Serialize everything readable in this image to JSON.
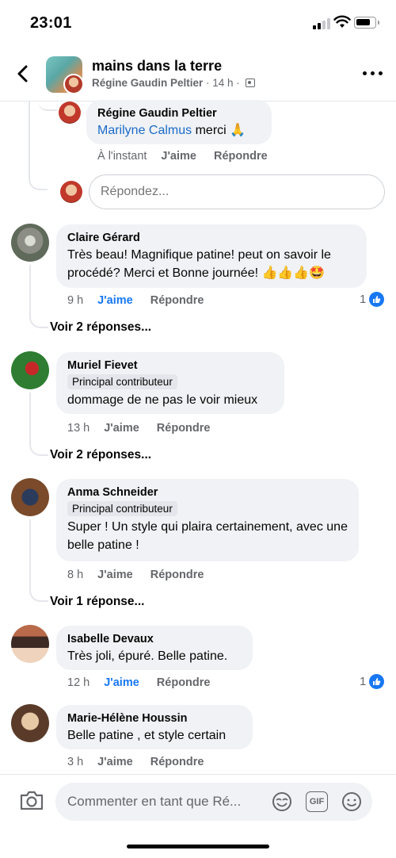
{
  "status_bar": {
    "time": "23:01"
  },
  "header": {
    "title": "mains dans la terre",
    "author": "Régine Gaudin Peltier",
    "time": " · 14 h · "
  },
  "reply": {
    "name": "Régine Gaudin Peltier",
    "mention": "Marilyne Calmus",
    "text": " merci 🙏",
    "time": "À l'instant",
    "like": "J'aime",
    "reply": "Répondre"
  },
  "reply_input": {
    "placeholder": "Répondez..."
  },
  "comments": [
    {
      "name": "Claire Gérard",
      "badge": "",
      "text": "Très beau! Magnifique patine! peut on savoir le procédé? Merci et Bonne journée! 👍👍👍🤩",
      "time": "9 h",
      "like": "J'aime",
      "reply": "Répondre",
      "reactions": "1",
      "see_replies": "Voir 2 réponses..."
    },
    {
      "name": "Muriel Fievet",
      "badge": "Principal contributeur",
      "text": "dommage de ne pas le voir mieux",
      "time": "13 h",
      "like": "J'aime",
      "reply": "Répondre",
      "see_replies": "Voir 2 réponses..."
    },
    {
      "name": "Anma Schneider",
      "badge": "Principal contributeur",
      "text": "Super ! Un style qui plaira certainement, avec une belle patine !",
      "time": "8 h",
      "like": "J'aime",
      "reply": "Répondre",
      "see_replies": "Voir 1 réponse..."
    },
    {
      "name": "Isabelle Devaux",
      "text": "Très joli, épuré. Belle patine.",
      "time": "12 h",
      "like": "J'aime",
      "reply": "Répondre",
      "liked": true,
      "reactions": "1"
    },
    {
      "name": "Marie-Hélène Houssin",
      "text": "Belle patine , et style certain",
      "time": "3 h",
      "like": "J'aime",
      "reply": "Répondre"
    }
  ],
  "composer": {
    "placeholder": "Commenter en tant que Ré...",
    "gif_label": "GIF"
  },
  "colors": {
    "accent": "#1877f2",
    "bubble": "#f0f2f5",
    "secondary_text": "#65676b"
  }
}
